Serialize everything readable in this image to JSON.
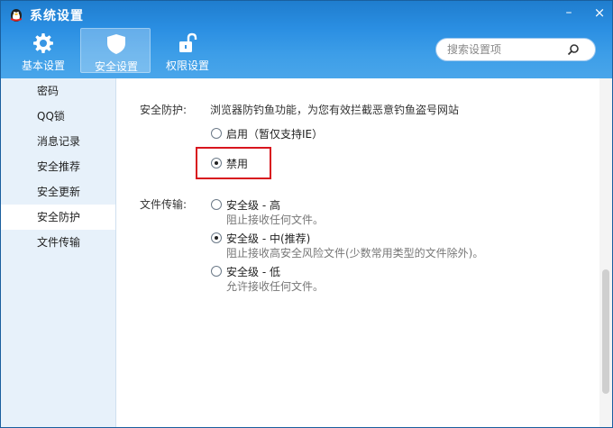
{
  "window": {
    "title": "系统设置",
    "minimize": "–",
    "close": "×"
  },
  "toolbar": {
    "tabs": [
      {
        "label": "基本设置",
        "icon": "gear-icon"
      },
      {
        "label": "安全设置",
        "icon": "shield-icon",
        "active": true
      },
      {
        "label": "权限设置",
        "icon": "unlock-icon"
      }
    ],
    "search": {
      "placeholder": "搜索设置项",
      "value": ""
    }
  },
  "sidebar": {
    "items": [
      {
        "label": "密码"
      },
      {
        "label": "QQ锁"
      },
      {
        "label": "消息记录"
      },
      {
        "label": "安全推荐"
      },
      {
        "label": "安全更新"
      },
      {
        "label": "安全防护",
        "active": true
      },
      {
        "label": "文件传输"
      }
    ]
  },
  "security": {
    "label": "安全防护:",
    "description": "浏览器防钓鱼功能，为您有效拦截恶意钓鱼盗号网站",
    "options": [
      {
        "label": "启用（暂仅支持IE）",
        "checked": false
      },
      {
        "label": "禁用",
        "checked": true
      }
    ]
  },
  "file_transfer": {
    "label": "文件传输:",
    "options": [
      {
        "label": "安全级 - 高",
        "desc": "阻止接收任何文件。",
        "checked": false
      },
      {
        "label": "安全级 - 中(推荐)",
        "desc": "阻止接收高安全风险文件(少数常用类型的文件除外)。",
        "checked": true
      },
      {
        "label": "安全级 - 低",
        "desc": "允许接收任何文件。",
        "checked": false
      }
    ]
  },
  "colors": {
    "titlebar": "#2a8ee2",
    "sidebar": "#e7f1fa",
    "highlight": "#d8151e"
  }
}
